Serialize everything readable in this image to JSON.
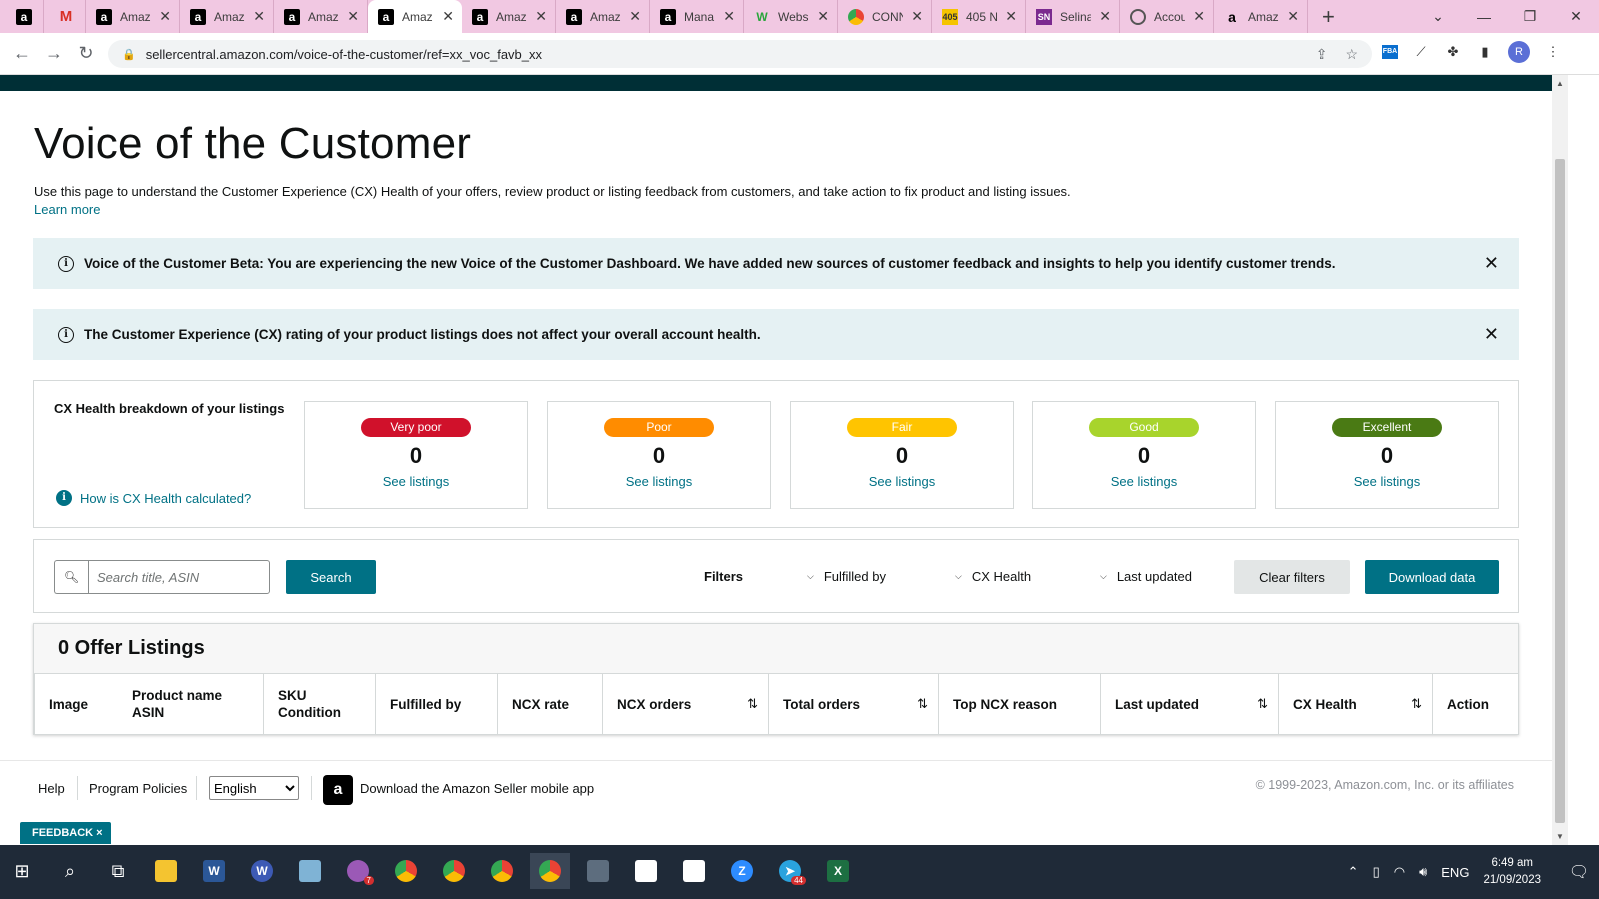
{
  "browser": {
    "tabs": [
      {
        "title": "",
        "icon": "amazon-icon"
      },
      {
        "title": "",
        "icon": "gmail-icon"
      },
      {
        "title": "Amaz",
        "icon": "amazon-icon"
      },
      {
        "title": "Amaz",
        "icon": "amazon-icon"
      },
      {
        "title": "Amaz",
        "icon": "amazon-icon"
      },
      {
        "title": "Amaz",
        "icon": "amazon-icon",
        "active": true
      },
      {
        "title": "Amaz",
        "icon": "amazon-icon"
      },
      {
        "title": "Amaz",
        "icon": "amazon-icon"
      },
      {
        "title": "Mana",
        "icon": "amazon-icon"
      },
      {
        "title": "Webs",
        "icon": "webs-icon"
      },
      {
        "title": "CONN",
        "icon": "chrome-icon"
      },
      {
        "title": "405 N",
        "icon": "405-icon"
      },
      {
        "title": "Selina",
        "icon": "sn-icon"
      },
      {
        "title": "Accou",
        "icon": "globe-icon"
      },
      {
        "title": "Amaz",
        "icon": "amazon-smile-icon"
      }
    ],
    "fav_text": {
      "amazon": "a",
      "gmail": "M",
      "webs": "W",
      "405": "405",
      "sn": "SN",
      "amazon_smile": "a"
    },
    "url": "sellercentral.amazon.com/voice-of-the-customer/ref=xx_voc_favb_xx",
    "profile_initial": "R",
    "fba_label": "FBA"
  },
  "page": {
    "title": "Voice of the Customer",
    "description": "Use this page to understand the Customer Experience (CX) Health of your offers, review product or listing feedback from customers, and take action to fix product and listing issues.",
    "learn_more": "Learn more",
    "alerts": [
      "Voice of the Customer Beta: You are experiencing the new Voice of the Customer Dashboard. We have added new sources of customer feedback and insights to help you identify customer trends.",
      "The Customer Experience (CX) rating of your product listings does not affect your overall account health."
    ],
    "cx": {
      "title": "CX Health breakdown of your listings",
      "how_link": "How is CX Health calculated?",
      "categories": [
        {
          "label": "Very poor",
          "count": "0",
          "link": "See listings",
          "color": "#d0112b"
        },
        {
          "label": "Poor",
          "count": "0",
          "link": "See listings",
          "color": "#ff8c00"
        },
        {
          "label": "Fair",
          "count": "0",
          "link": "See listings",
          "color": "#ffc400"
        },
        {
          "label": "Good",
          "count": "0",
          "link": "See listings",
          "color": "#a8d42c"
        },
        {
          "label": "Excellent",
          "count": "0",
          "link": "See listings",
          "color": "#4a7a14"
        }
      ]
    },
    "filters": {
      "search_placeholder": "Search title, ASIN",
      "search_button": "Search",
      "label": "Filters",
      "dropdowns": [
        "Fulfilled by",
        "CX Health",
        "Last updated"
      ],
      "clear_button": "Clear filters",
      "download_button": "Download data"
    },
    "table": {
      "title": "0 Offer Listings",
      "columns": [
        {
          "line1": "Image",
          "line2": ""
        },
        {
          "line1": "Product name",
          "line2": "ASIN"
        },
        {
          "line1": "SKU",
          "line2": "Condition"
        },
        {
          "line1": "Fulfilled by",
          "line2": ""
        },
        {
          "line1": "NCX rate",
          "line2": ""
        },
        {
          "line1": "NCX orders",
          "line2": "",
          "sortable": true
        },
        {
          "line1": "Total orders",
          "line2": "",
          "sortable": true
        },
        {
          "line1": "Top NCX reason",
          "line2": ""
        },
        {
          "line1": "Last updated",
          "line2": "",
          "sortable": true
        },
        {
          "line1": "CX Health",
          "line2": "",
          "sortable": true
        },
        {
          "line1": "Action",
          "line2": ""
        }
      ]
    },
    "footer": {
      "help": "Help",
      "policies": "Program Policies",
      "language": "English",
      "app_text": "Download the Amazon Seller mobile app",
      "copyright": "© 1999-2023, Amazon.com, Inc. or its affiliates"
    },
    "feedback": "FEEDBACK ×"
  },
  "taskbar": {
    "apps": [
      "windows-start-icon",
      "search-icon",
      "task-view-icon",
      "file-explorer-icon",
      "word-icon",
      "wps-icon",
      "notepad-icon",
      "feather-icon",
      "chrome-icon",
      "chrome-icon",
      "chrome-icon",
      "chrome-icon",
      "calculator-icon",
      "chart-app-icon",
      "chart-app-icon",
      "zoom-icon",
      "telegram-icon",
      "excel-icon"
    ],
    "lang": "ENG",
    "time": "6:49 am",
    "date": "21/09/2023",
    "badges": {
      "feather": "7",
      "telegram": "44"
    }
  }
}
